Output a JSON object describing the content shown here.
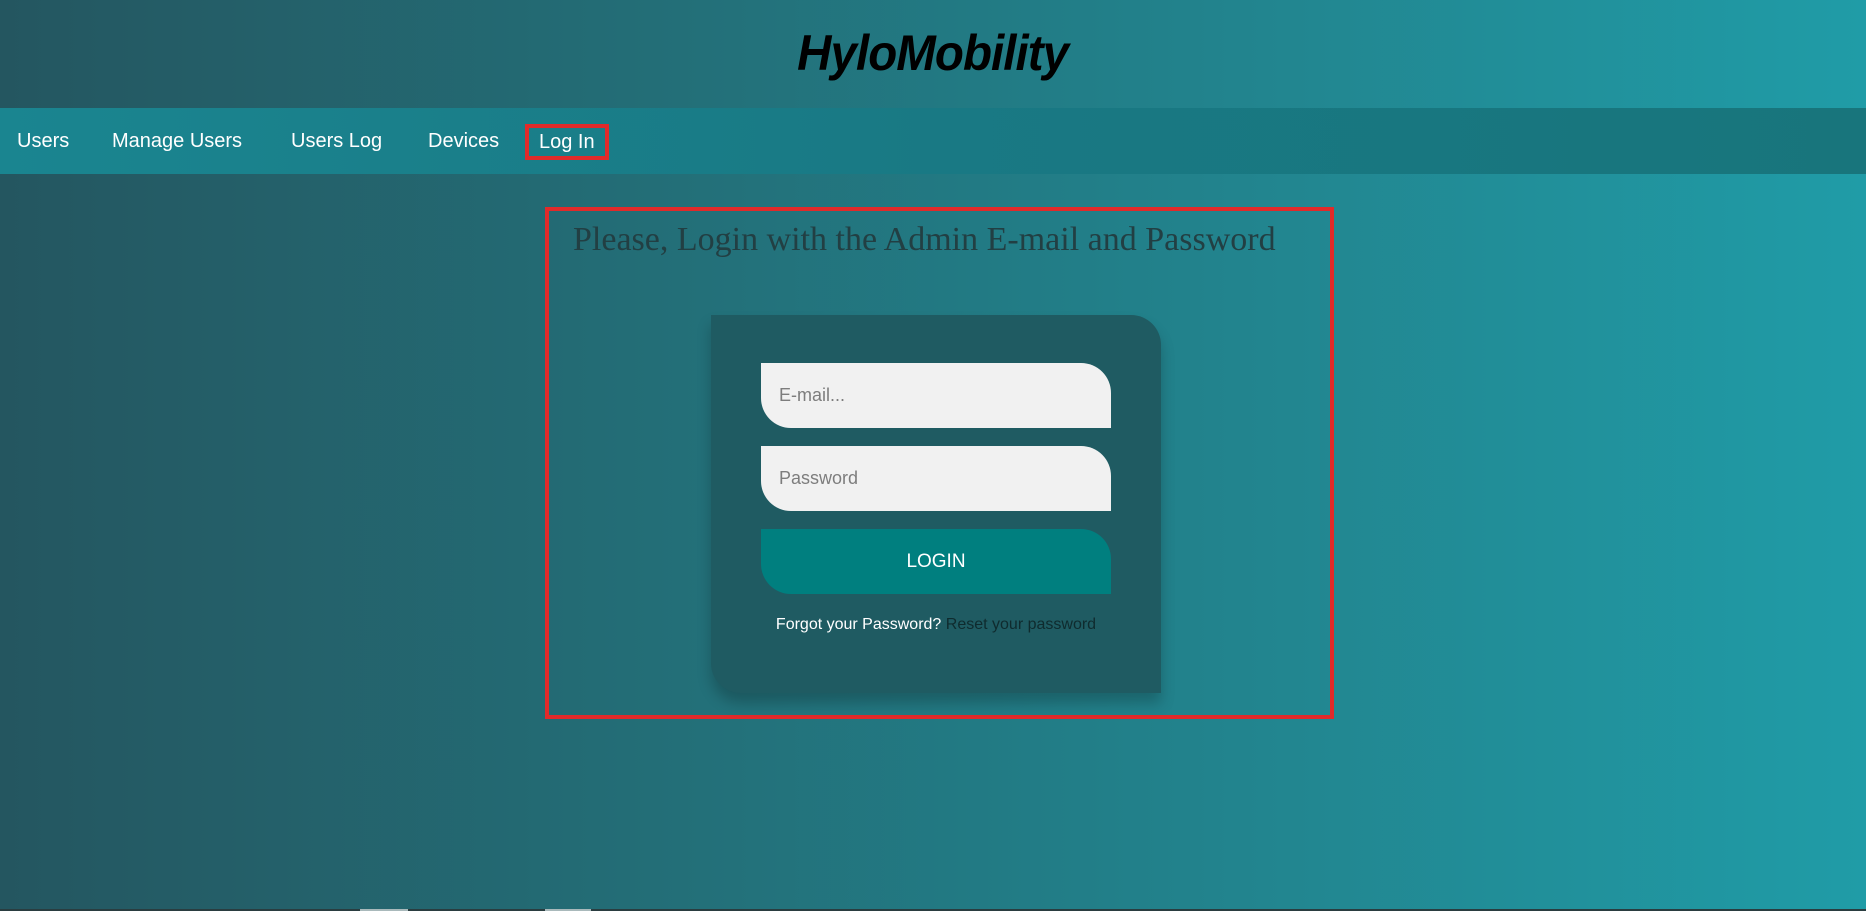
{
  "header": {
    "brand": "HyloMobility"
  },
  "nav": {
    "items": [
      {
        "label": "Users"
      },
      {
        "label": "Manage Users"
      },
      {
        "label": "Users Log"
      },
      {
        "label": "Devices"
      },
      {
        "label": "Log In",
        "active": true
      }
    ]
  },
  "login": {
    "title": "Please, Login with the Admin E-mail and Password",
    "email_placeholder": "E-mail...",
    "password_placeholder": "Password",
    "button_label": "LOGIN",
    "forgot_text": "Forgot your Password?",
    "reset_link": "Reset your password"
  },
  "colors": {
    "highlight": "#e12a2a",
    "card": "#1f5b62",
    "button": "#007f7f"
  }
}
